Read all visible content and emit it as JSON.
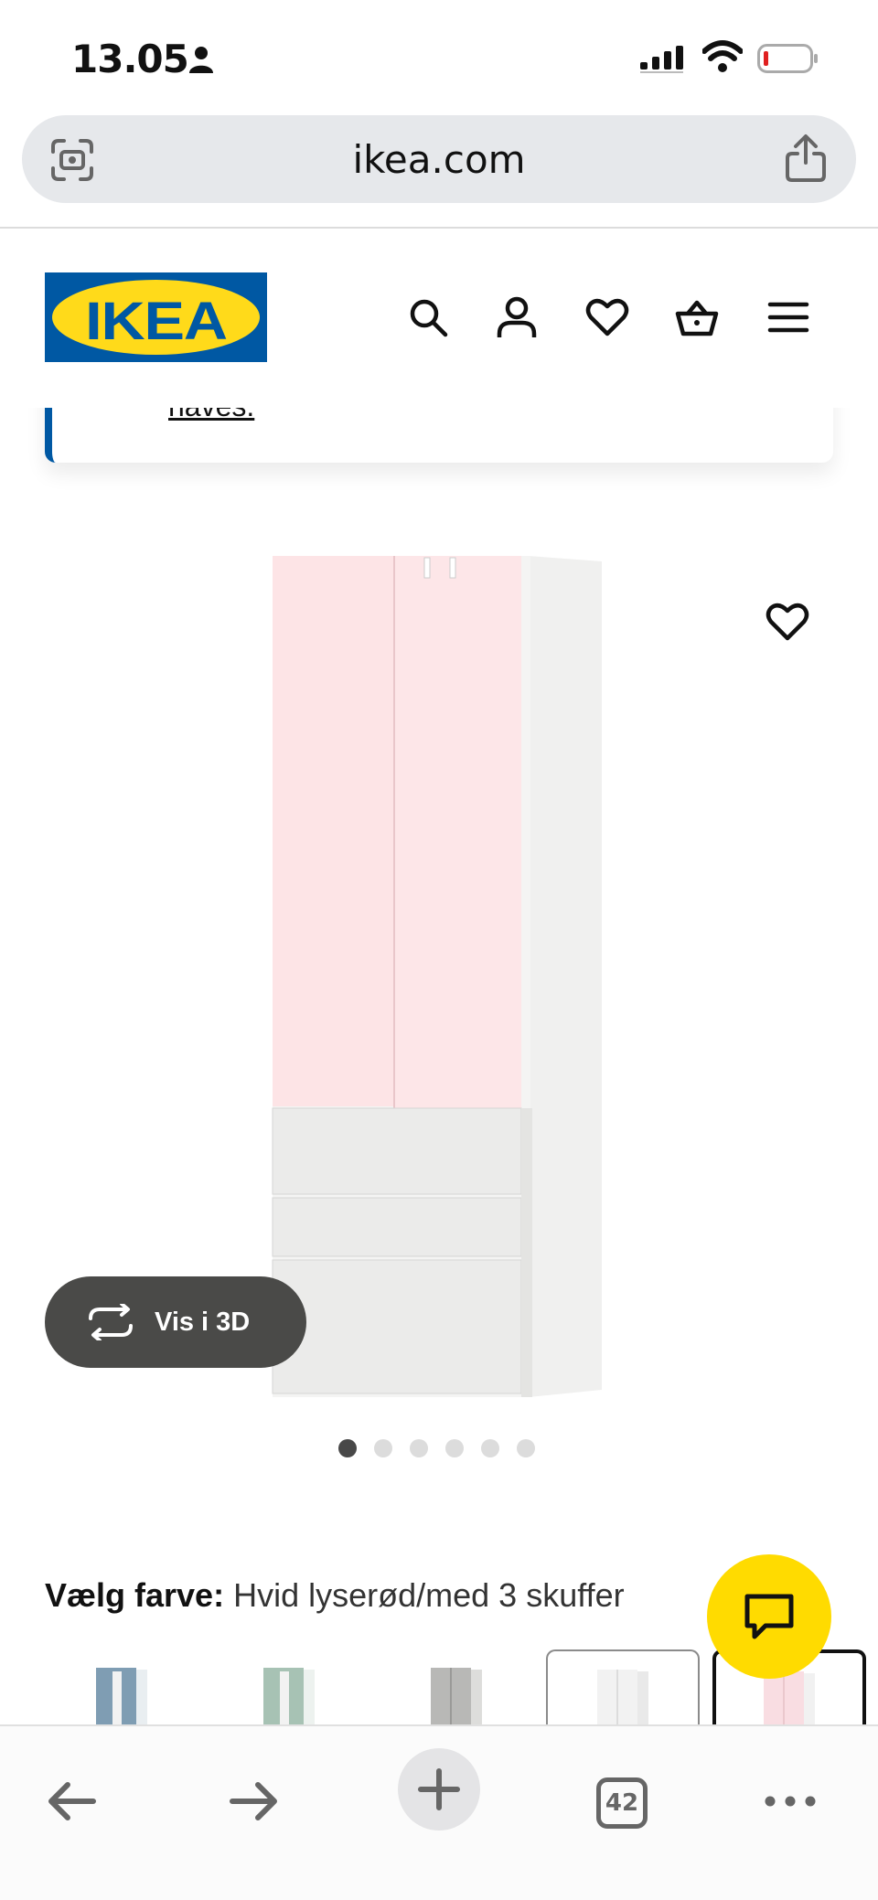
{
  "status_bar": {
    "time": "13.05"
  },
  "browser": {
    "url": "ikea.com",
    "open_tabs": "42"
  },
  "site": {
    "logo_text": "IKEA",
    "brand_colors": {
      "blue": "#0058a3",
      "yellow": "#ffda1a"
    },
    "header_icons": [
      "search-icon",
      "account-icon",
      "heart-icon",
      "basket-icon",
      "menu-icon"
    ]
  },
  "notice": {
    "link_text": "haves."
  },
  "product": {
    "view_3d_label": "Vis i 3D",
    "gallery": {
      "image_count": 6,
      "active_index": 0
    },
    "colour_label": "Vælg farve:",
    "colour_value": "Hvid lyserød/med 3 skuffer",
    "swatches": [
      {
        "name": "blue",
        "color": "#7f9db3",
        "selected": false
      },
      {
        "name": "mint",
        "color": "#a7c2b4",
        "selected": false
      },
      {
        "name": "grey",
        "color": "#b8b8b6",
        "selected": false
      },
      {
        "name": "white",
        "color": "#f2f2f2",
        "selected": "light"
      },
      {
        "name": "pink",
        "color": "#f9dde2",
        "selected": "dark"
      }
    ]
  },
  "chat": {
    "icon": "chat-icon",
    "accent_color": "#ffdb00"
  }
}
